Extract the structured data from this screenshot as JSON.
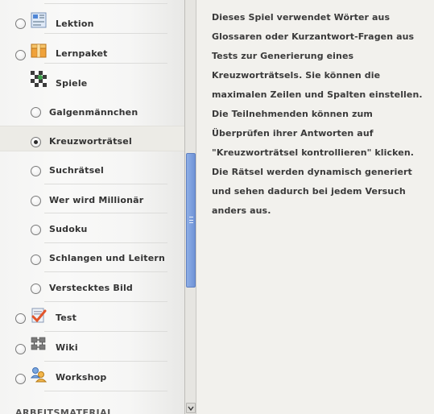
{
  "activity_list": {
    "items": [
      {
        "id": "lektion",
        "label": "Lektion",
        "icon": "lesson-icon",
        "radio": true
      },
      {
        "id": "lernpaket",
        "label": "Lernpaket",
        "icon": "package-icon",
        "radio": true
      },
      {
        "id": "spiele",
        "label": "Spiele",
        "icon": "games-icon",
        "radio": false
      },
      {
        "id": "galgenmaennchen",
        "label": "Galgenmännchen",
        "radio": true
      },
      {
        "id": "kreuzwortraetsel",
        "label": "Kreuzworträtsel",
        "radio": true,
        "selected": true
      },
      {
        "id": "suchraetsel",
        "label": "Suchrätsel",
        "radio": true
      },
      {
        "id": "millionaer",
        "label": "Wer wird Millionär",
        "radio": true
      },
      {
        "id": "sudoku",
        "label": "Sudoku",
        "radio": true
      },
      {
        "id": "schlangen",
        "label": "Schlangen und Leitern",
        "radio": true
      },
      {
        "id": "bild",
        "label": "Verstecktes Bild",
        "radio": true
      },
      {
        "id": "test",
        "label": "Test",
        "icon": "test-checkmark-icon",
        "radio": true
      },
      {
        "id": "wiki",
        "label": "Wiki",
        "icon": "wiki-icon",
        "radio": true
      },
      {
        "id": "workshop",
        "label": "Workshop",
        "icon": "workshop-icon",
        "radio": true
      }
    ],
    "section_heading": "ARBEITSMATERIAL"
  },
  "description": "Dieses Spiel verwendet Wörter aus Glossaren oder Kurzantwort-Fragen aus Tests zur Generierung eines Kreuzworträtsels. Sie können die maximalen Zeilen und Spalten einstellen. Die Teilnehmenden können zum Überprüfen ihrer Antworten auf \"Kreuzworträtsel kontrollieren\" klicken. Die Rätsel werden dynamisch generiert und sehen dadurch bei jedem Versuch anders aus.",
  "colors": {
    "scrollbar_thumb": "#7a9ddf",
    "selected_row": "#ecebe6",
    "pane_background": "#f2f1ed"
  }
}
